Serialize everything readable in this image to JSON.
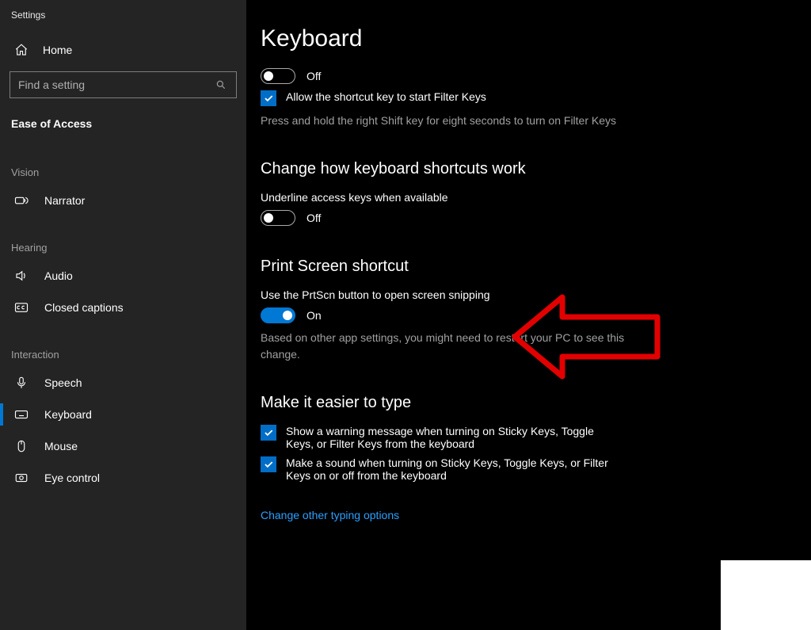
{
  "window": {
    "title": "Settings"
  },
  "sidebar": {
    "home": "Home",
    "search_placeholder": "Find a setting",
    "crumb": "Ease of Access",
    "groups": [
      {
        "label": "Vision",
        "items": [
          {
            "label": "Narrator"
          }
        ]
      },
      {
        "label": "Hearing",
        "items": [
          {
            "label": "Audio"
          },
          {
            "label": "Closed captions"
          }
        ]
      },
      {
        "label": "Interaction",
        "items": [
          {
            "label": "Speech"
          },
          {
            "label": "Keyboard",
            "selected": true
          },
          {
            "label": "Mouse"
          },
          {
            "label": "Eye control"
          }
        ]
      }
    ]
  },
  "main": {
    "title": "Keyboard",
    "filter": {
      "state": "Off",
      "check_label": "Allow the shortcut key to start Filter Keys",
      "hint": "Press and hold the right Shift key for eight seconds to turn on Filter Keys"
    },
    "shortcuts": {
      "heading": "Change how keyboard shortcuts work",
      "underline_label": "Underline access keys when available",
      "underline_state": "Off"
    },
    "prtscn": {
      "heading": "Print Screen shortcut",
      "line": "Use the PrtScn button to open screen snipping",
      "state": "On",
      "hint": "Based on other app settings, you might need to restart your PC to see this change."
    },
    "easier": {
      "heading": "Make it easier to type",
      "opt1": "Show a warning message when turning on Sticky Keys, Toggle Keys, or Filter Keys from the keyboard",
      "opt2": "Make a sound when turning on Sticky Keys, Toggle Keys, or Filter Keys on or off from the keyboard",
      "link": "Change other typing options"
    }
  }
}
